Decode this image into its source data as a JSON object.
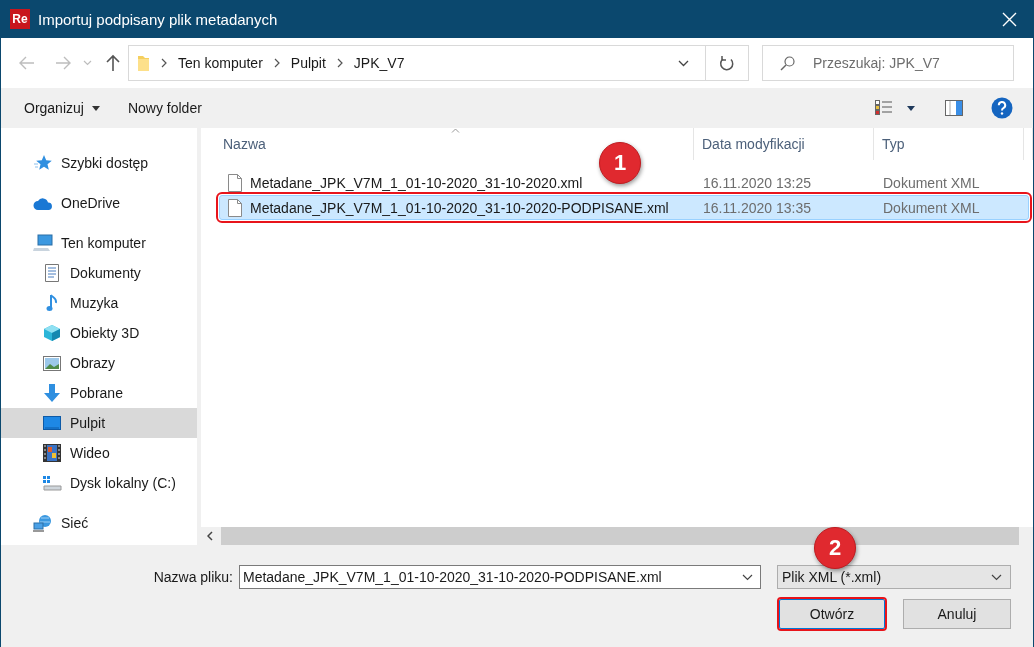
{
  "window": {
    "app_icon": "Re",
    "title": "Importuj podpisany plik metadanych"
  },
  "address_bar": {
    "path": [
      "Ten komputer",
      "Pulpit",
      "JPK_V7"
    ],
    "search_placeholder": "Przeszukaj: JPK_V7"
  },
  "toolbar": {
    "organize": "Organizuj",
    "new_folder": "Nowy folder"
  },
  "sidebar": {
    "items": [
      {
        "label": "Szybki dostęp",
        "selected": false
      },
      {
        "label": "OneDrive",
        "selected": false
      },
      {
        "label": "Ten komputer",
        "selected": false,
        "children": [
          {
            "label": "Dokumenty",
            "selected": false
          },
          {
            "label": "Muzyka",
            "selected": false
          },
          {
            "label": "Obiekty 3D",
            "selected": false
          },
          {
            "label": "Obrazy",
            "selected": false
          },
          {
            "label": "Pobrane",
            "selected": false
          },
          {
            "label": "Pulpit",
            "selected": true
          },
          {
            "label": "Wideo",
            "selected": false
          },
          {
            "label": "Dysk lokalny (C:)",
            "selected": false
          }
        ]
      },
      {
        "label": "Sieć",
        "selected": false
      }
    ]
  },
  "file_list": {
    "columns": [
      "Nazwa",
      "Data modyfikacji",
      "Typ"
    ],
    "rows": [
      {
        "name": "Metadane_JPK_V7M_1_01-10-2020_31-10-2020.xml",
        "modified": "16.11.2020 13:25",
        "type": "Dokument XML",
        "selected": false,
        "highlighted": false
      },
      {
        "name": "Metadane_JPK_V7M_1_01-10-2020_31-10-2020-PODPISANE.xml",
        "modified": "16.11.2020 13:35",
        "type": "Dokument XML",
        "selected": true,
        "highlighted": true
      }
    ]
  },
  "footer": {
    "filename_label": "Nazwa pliku:",
    "filename": "Metadane_JPK_V7M_1_01-10-2020_31-10-2020-PODPISANE.xml",
    "file_type": "Plik XML (*.xml)",
    "buttons": [
      {
        "label": "Otwórz",
        "highlighted": true
      },
      {
        "label": "Anuluj",
        "highlighted": false
      }
    ]
  },
  "annotations": [
    {
      "label": "1"
    },
    {
      "label": "2"
    }
  ]
}
